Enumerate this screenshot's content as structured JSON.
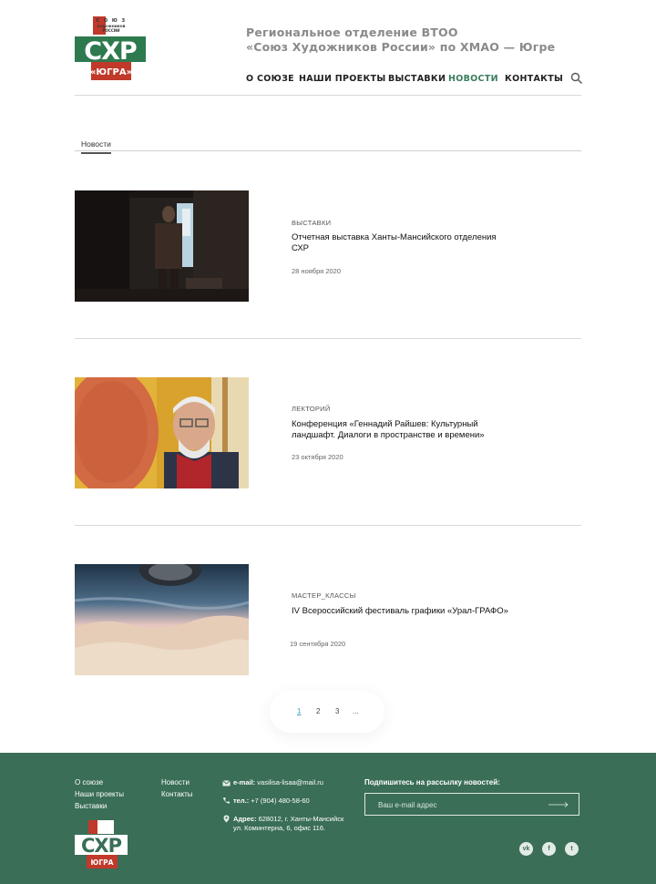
{
  "header": {
    "logo": {
      "top_text": "СОЮЗ ХУДОЖНИКОВ РОССИИ",
      "main": "СХР",
      "sub": "«ЮГРА»"
    },
    "title_line1": "Региональное отделение ВТОО",
    "title_line2": "«Союз Художников России» по ХМАО — Югре",
    "nav": [
      {
        "label": "О СОЮЗЕ"
      },
      {
        "label": "НАШИ ПРОЕКТЫ"
      },
      {
        "label": "ВЫСТАВКИ"
      },
      {
        "label": "НОВОСТИ"
      },
      {
        "label": "КОНТАКТЫ"
      }
    ],
    "active_nav": "НОВОСТИ",
    "accent_color": "#3a7d5c"
  },
  "breadcrumb": {
    "label": "Новости"
  },
  "news": [
    {
      "category": "ВЫСТАВКИ",
      "title": "Отчетная выставка Ханты-Мансийского отделения СХР",
      "date": "28 ноября 2020"
    },
    {
      "category": "ЛЕКТОРИЙ",
      "title": "Конференция «Геннадий Райшев: Культурный ландшафт. Диалоги в пространстве и времени»",
      "date": "23 октября 2020"
    },
    {
      "category": "МАСТЕР_КЛАССЫ",
      "title": "IV Всероссийский фестиваль графики «Урал-ГРАФО»",
      "date": "19 сентября 2020"
    }
  ],
  "pagination": {
    "pages": [
      "1",
      "2",
      "3",
      "..."
    ],
    "current": "1"
  },
  "footer": {
    "col1": [
      "О союзе",
      "Наши проекты",
      "Выставки"
    ],
    "col2": [
      "Новости",
      "Контакты"
    ],
    "email_label": "e-mail:",
    "email": "vasilisa-lisaa@mail.ru",
    "phone_label": "тел.:",
    "phone": "+7 (904) 480-58-60",
    "address_label": "Адрес:",
    "address_line1": "628012, г. Ханты-Мансийск",
    "address_line2": "ул. Коминтерна, 6, офис 116.",
    "subscribe_title": "Подпишитесь на рассылку новостей:",
    "subscribe_placeholder": "Ваш e-mail адрес",
    "social": [
      "vk",
      "f",
      "t"
    ],
    "bg_color": "#3a6e57"
  }
}
